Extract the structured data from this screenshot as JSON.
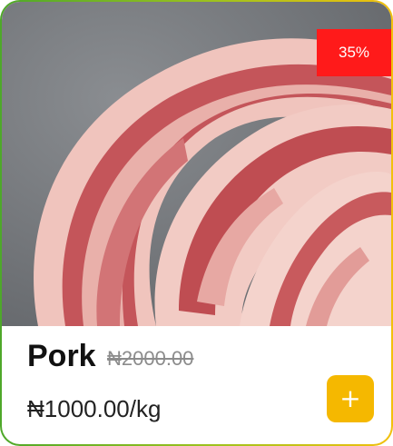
{
  "product": {
    "name": "Pork",
    "old_price": "₦2000.00",
    "price": "₦1000.00",
    "unit": "/kg",
    "discount": "35%",
    "add_label": "+",
    "image_icon": "pork-belly-image"
  },
  "colors": {
    "badge": "#ff1a1a",
    "add_button": "#f5b800",
    "border_start": "#4ea82a",
    "border_end": "#f2c00d"
  }
}
